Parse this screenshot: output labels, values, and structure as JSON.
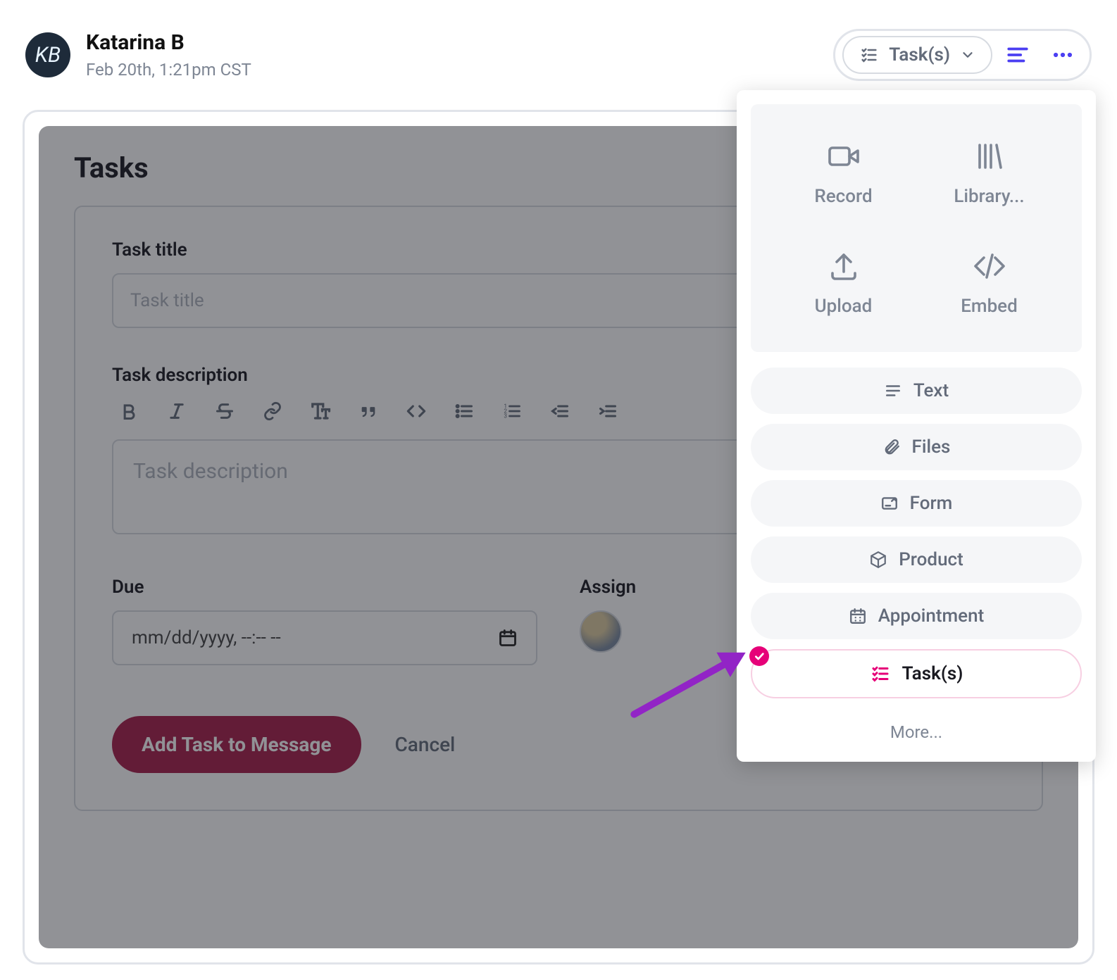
{
  "header": {
    "user_name": "Katarina B",
    "timestamp": "Feb 20th, 1:21pm CST",
    "avatar_initials": "KB",
    "pill_label": "Task(s)"
  },
  "page": {
    "title": "Tasks"
  },
  "form": {
    "title_label": "Task title",
    "title_placeholder": "Task title",
    "title_value": "",
    "desc_label": "Task description",
    "desc_placeholder": "Task description",
    "desc_value": "",
    "due_label": "Due",
    "due_value": "mm/dd/yyyy, --:-- --",
    "assign_label": "Assign",
    "submit_label": "Add Task to Message",
    "cancel_label": "Cancel"
  },
  "popover": {
    "media": [
      {
        "id": "record",
        "label": "Record"
      },
      {
        "id": "library",
        "label": "Library..."
      },
      {
        "id": "upload",
        "label": "Upload"
      },
      {
        "id": "embed",
        "label": "Embed"
      }
    ],
    "menu": [
      {
        "id": "text",
        "label": "Text",
        "selected": false
      },
      {
        "id": "files",
        "label": "Files",
        "selected": false
      },
      {
        "id": "form",
        "label": "Form",
        "selected": false
      },
      {
        "id": "product",
        "label": "Product",
        "selected": false
      },
      {
        "id": "appointment",
        "label": "Appointment",
        "selected": false
      },
      {
        "id": "tasks",
        "label": "Task(s)",
        "selected": true
      }
    ],
    "more_label": "More..."
  },
  "colors": {
    "brand_red": "#A81D4A",
    "brand_purple": "#4B3FF2",
    "accent_pink": "#E60078",
    "arrow_purple": "#9224C6"
  }
}
